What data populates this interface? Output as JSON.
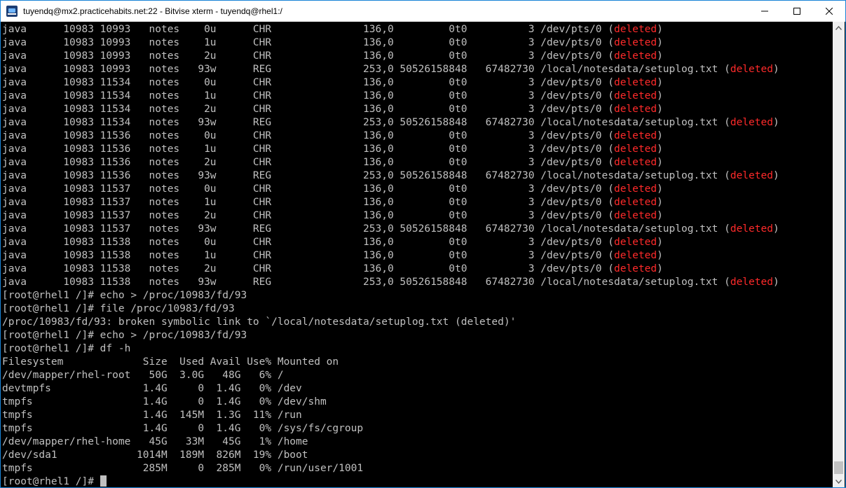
{
  "window": {
    "title": "tuyendq@mx2.practicehabits.net:22 - Bitvise xterm - tuyendq@rhel1:/",
    "minimize_icon": "minimize-icon",
    "maximize_icon": "maximize-icon",
    "close_icon": "close-icon"
  },
  "colors": {
    "background": "#000000",
    "text": "#c0c0c0",
    "deleted": "#ff2a2a",
    "titlebar": "#ffffff"
  },
  "terminal": {
    "lsof_rows": [
      {
        "text": "java      10983 10993   notes    0u      CHR               136,0         0t0          3 /dev/pts/0 (",
        "flag": "deleted",
        "close": ")"
      },
      {
        "text": "java      10983 10993   notes    1u      CHR               136,0         0t0          3 /dev/pts/0 (",
        "flag": "deleted",
        "close": ")"
      },
      {
        "text": "java      10983 10993   notes    2u      CHR               136,0         0t0          3 /dev/pts/0 (",
        "flag": "deleted",
        "close": ")"
      },
      {
        "text": "java      10983 10993   notes   93w      REG               253,0 50526158848   67482730 /local/notesdata/setuplog.txt (",
        "flag": "deleted",
        "close": ")"
      },
      {
        "text": "java      10983 11534   notes    0u      CHR               136,0         0t0          3 /dev/pts/0 (",
        "flag": "deleted",
        "close": ")"
      },
      {
        "text": "java      10983 11534   notes    1u      CHR               136,0         0t0          3 /dev/pts/0 (",
        "flag": "deleted",
        "close": ")"
      },
      {
        "text": "java      10983 11534   notes    2u      CHR               136,0         0t0          3 /dev/pts/0 (",
        "flag": "deleted",
        "close": ")"
      },
      {
        "text": "java      10983 11534   notes   93w      REG               253,0 50526158848   67482730 /local/notesdata/setuplog.txt (",
        "flag": "deleted",
        "close": ")"
      },
      {
        "text": "java      10983 11536   notes    0u      CHR               136,0         0t0          3 /dev/pts/0 (",
        "flag": "deleted",
        "close": ")"
      },
      {
        "text": "java      10983 11536   notes    1u      CHR               136,0         0t0          3 /dev/pts/0 (",
        "flag": "deleted",
        "close": ")"
      },
      {
        "text": "java      10983 11536   notes    2u      CHR               136,0         0t0          3 /dev/pts/0 (",
        "flag": "deleted",
        "close": ")"
      },
      {
        "text": "java      10983 11536   notes   93w      REG               253,0 50526158848   67482730 /local/notesdata/setuplog.txt (",
        "flag": "deleted",
        "close": ")"
      },
      {
        "text": "java      10983 11537   notes    0u      CHR               136,0         0t0          3 /dev/pts/0 (",
        "flag": "deleted",
        "close": ")"
      },
      {
        "text": "java      10983 11537   notes    1u      CHR               136,0         0t0          3 /dev/pts/0 (",
        "flag": "deleted",
        "close": ")"
      },
      {
        "text": "java      10983 11537   notes    2u      CHR               136,0         0t0          3 /dev/pts/0 (",
        "flag": "deleted",
        "close": ")"
      },
      {
        "text": "java      10983 11537   notes   93w      REG               253,0 50526158848   67482730 /local/notesdata/setuplog.txt (",
        "flag": "deleted",
        "close": ")"
      },
      {
        "text": "java      10983 11538   notes    0u      CHR               136,0         0t0          3 /dev/pts/0 (",
        "flag": "deleted",
        "close": ")"
      },
      {
        "text": "java      10983 11538   notes    1u      CHR               136,0         0t0          3 /dev/pts/0 (",
        "flag": "deleted",
        "close": ")"
      },
      {
        "text": "java      10983 11538   notes    2u      CHR               136,0         0t0          3 /dev/pts/0 (",
        "flag": "deleted",
        "close": ")"
      },
      {
        "text": "java      10983 11538   notes   93w      REG               253,0 50526158848   67482730 /local/notesdata/setuplog.txt (",
        "flag": "deleted",
        "close": ")"
      }
    ],
    "session_lines": [
      "[root@rhel1 /]# echo > /proc/10983/fd/93",
      "[root@rhel1 /]# file /proc/10983/fd/93",
      "/proc/10983/fd/93: broken symbolic link to `/local/notesdata/setuplog.txt (deleted)'",
      "[root@rhel1 /]# echo > /proc/10983/fd/93",
      "[root@rhel1 /]# df -h",
      "Filesystem             Size  Used Avail Use% Mounted on",
      "/dev/mapper/rhel-root   50G  3.0G   48G   6% /",
      "devtmpfs               1.4G     0  1.4G   0% /dev",
      "tmpfs                  1.4G     0  1.4G   0% /dev/shm",
      "tmpfs                  1.4G  145M  1.3G  11% /run",
      "tmpfs                  1.4G     0  1.4G   0% /sys/fs/cgroup",
      "/dev/mapper/rhel-home   45G   33M   45G   1% /home",
      "/dev/sda1             1014M  189M  826M  19% /boot",
      "tmpfs                  285M     0  285M   0% /run/user/1001"
    ],
    "prompt": "[root@rhel1 /]# "
  },
  "scrollbar": {
    "up_icon": "scroll-up-arrow-icon",
    "down_icon": "scroll-down-arrow-icon"
  }
}
